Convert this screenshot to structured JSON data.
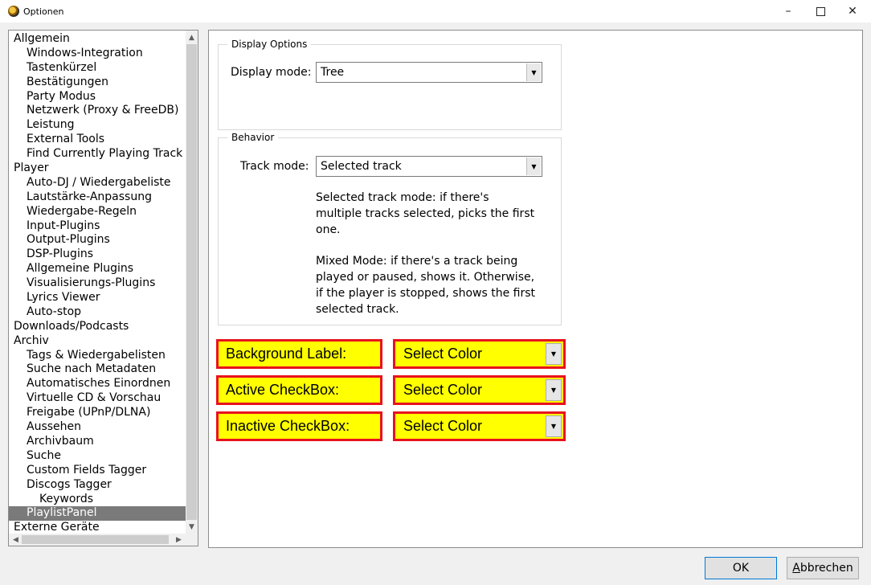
{
  "window": {
    "title": "Optionen",
    "minimize": "–",
    "close": "✕"
  },
  "tree": {
    "items": [
      {
        "label": "Allgemein",
        "level": 0
      },
      {
        "label": "Windows-Integration",
        "level": 1
      },
      {
        "label": "Tastenkürzel",
        "level": 1
      },
      {
        "label": "Bestätigungen",
        "level": 1
      },
      {
        "label": "Party Modus",
        "level": 1
      },
      {
        "label": "Netzwerk (Proxy & FreeDB)",
        "level": 1
      },
      {
        "label": "Leistung",
        "level": 1
      },
      {
        "label": "External Tools",
        "level": 1
      },
      {
        "label": "Find Currently Playing Track",
        "level": 1
      },
      {
        "label": "Player",
        "level": 0
      },
      {
        "label": "Auto-DJ / Wiedergabeliste",
        "level": 1
      },
      {
        "label": "Lautstärke-Anpassung",
        "level": 1
      },
      {
        "label": "Wiedergabe-Regeln",
        "level": 1
      },
      {
        "label": "Input-Plugins",
        "level": 1
      },
      {
        "label": "Output-Plugins",
        "level": 1
      },
      {
        "label": "DSP-Plugins",
        "level": 1
      },
      {
        "label": "Allgemeine Plugins",
        "level": 1
      },
      {
        "label": "Visualisierungs-Plugins",
        "level": 1
      },
      {
        "label": "Lyrics Viewer",
        "level": 1
      },
      {
        "label": "Auto-stop",
        "level": 1
      },
      {
        "label": "Downloads/Podcasts",
        "level": 0
      },
      {
        "label": "Archiv",
        "level": 0
      },
      {
        "label": "Tags & Wiedergabelisten",
        "level": 1
      },
      {
        "label": "Suche nach Metadaten",
        "level": 1
      },
      {
        "label": "Automatisches Einordnen",
        "level": 1
      },
      {
        "label": "Virtuelle CD & Vorschau",
        "level": 1
      },
      {
        "label": "Freigabe (UPnP/DLNA)",
        "level": 1
      },
      {
        "label": "Aussehen",
        "level": 1
      },
      {
        "label": "Archivbaum",
        "level": 1
      },
      {
        "label": "Suche",
        "level": 1
      },
      {
        "label": "Custom Fields Tagger",
        "level": 1
      },
      {
        "label": "Discogs Tagger",
        "level": 1
      },
      {
        "label": "Keywords",
        "level": 2
      },
      {
        "label": "PlaylistPanel",
        "level": 1,
        "selected": true
      },
      {
        "label": "Externe Geräte",
        "level": 0
      }
    ]
  },
  "display_options": {
    "title": "Display Options",
    "mode_label": "Display mode:",
    "mode_value": "Tree"
  },
  "behavior": {
    "title": "Behavior",
    "track_label": "Track mode:",
    "track_value": "Selected track",
    "desc_lines": [
      "Selected track mode:   if there's",
      "multiple tracks selected, picks the first",
      "one.",
      "",
      "Mixed Mode:   if there's a track being",
      "played or paused, shows it. Otherwise,",
      "if the player is stopped, shows the first",
      "selected track."
    ]
  },
  "colors": [
    {
      "label": "Background Label:",
      "value": "Select Color"
    },
    {
      "label": "Active CheckBox:",
      "value": "Select Color"
    },
    {
      "label": "Inactive CheckBox:",
      "value": "Select Color"
    }
  ],
  "accent": {
    "highlight_fill": "#ffff00",
    "highlight_border": "#e8121e",
    "selection": "#7a7a7a"
  },
  "buttons": {
    "ok": "OK",
    "cancel": "Abbrechen"
  }
}
